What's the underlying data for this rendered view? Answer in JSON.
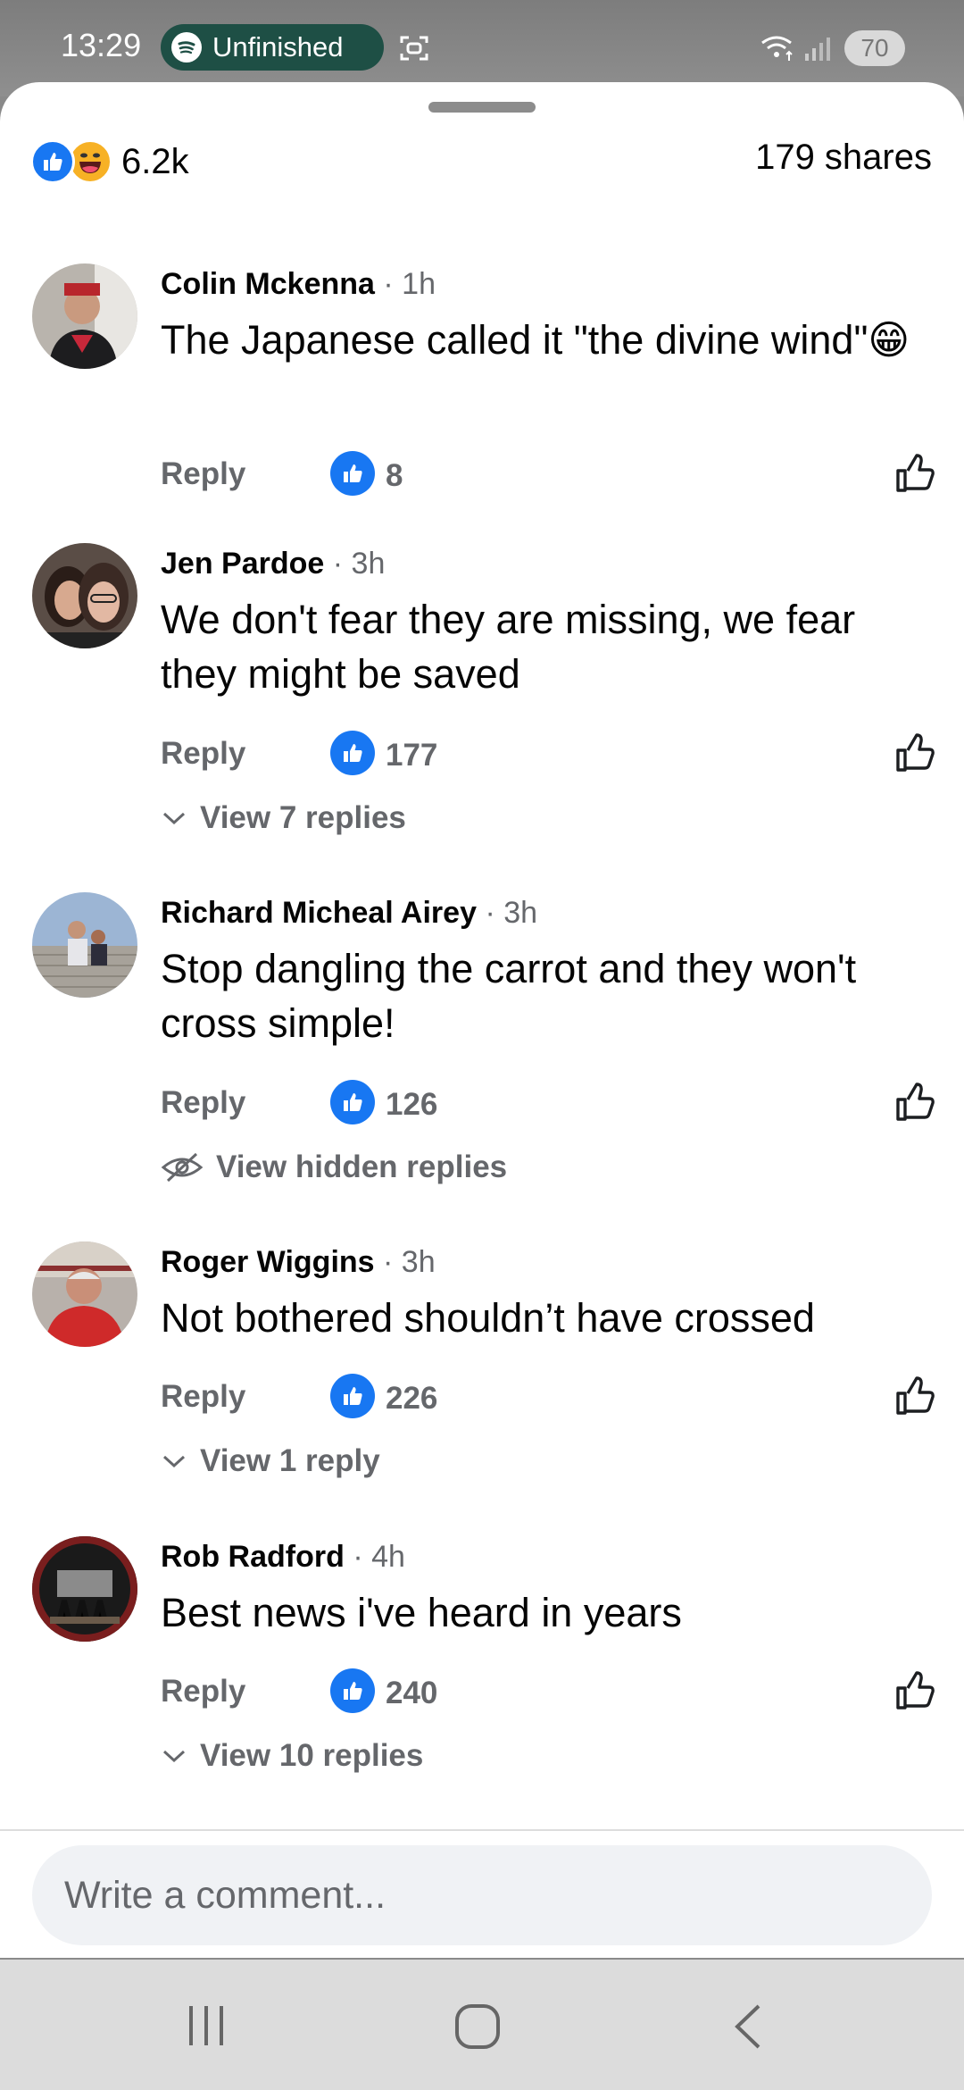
{
  "status_bar": {
    "time": "13:29",
    "spotify_label": "Unfinished",
    "battery": "70"
  },
  "sheet": {
    "reaction_count": "6.2k",
    "shares": "179 shares"
  },
  "comments": [
    {
      "author": "Colin Mckenna",
      "time": "· 1h",
      "text": "The Japanese called it \"the divine wind\"😁",
      "reply_label": "Reply",
      "likes": "8",
      "view_replies": ""
    },
    {
      "author": "Jen Pardoe",
      "time": "· 3h",
      "text": "We don't fear they are missing, we fear they might be saved",
      "reply_label": "Reply",
      "likes": "177",
      "view_replies": "View 7 replies"
    },
    {
      "author": "Richard Micheal Airey",
      "time": "· 3h",
      "text": "Stop dangling the carrot and they won't cross simple!",
      "reply_label": "Reply",
      "likes": "126",
      "view_replies": "View hidden replies"
    },
    {
      "author": "Roger Wiggins",
      "time": "· 3h",
      "text": "Not bothered shouldn’t have crossed",
      "reply_label": "Reply",
      "likes": "226",
      "view_replies": "View 1 reply"
    },
    {
      "author": "Rob Radford",
      "time": "· 4h",
      "text": "Best news i've heard in years",
      "reply_label": "Reply",
      "likes": "240",
      "view_replies": "View 10 replies"
    }
  ],
  "composer": {
    "placeholder": "Write a comment..."
  },
  "colors": {
    "facebook_blue": "#1877f2",
    "secondary_text": "#65676b",
    "spotify_pill": "#1e4f45"
  },
  "icons": [
    "spotify-icon",
    "screen-record-icon",
    "wifi-icon",
    "signal-icon",
    "like-reaction-icon",
    "haha-reaction-icon",
    "like-outline-icon",
    "chevron-down-icon",
    "eye-slash-icon",
    "recents-icon",
    "home-icon",
    "back-icon"
  ]
}
